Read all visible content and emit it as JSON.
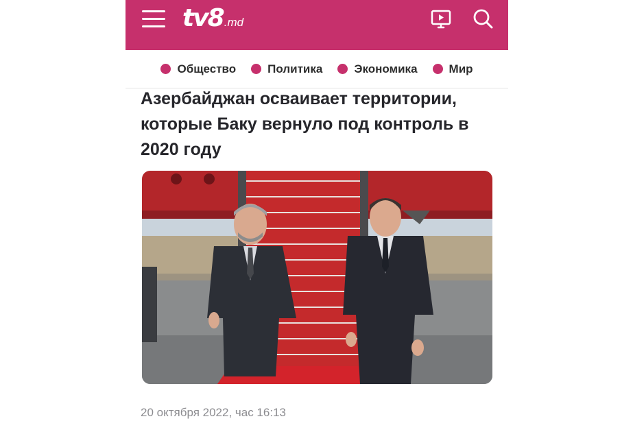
{
  "header": {
    "logo_main": "tv8",
    "logo_sub": ".md",
    "brand_color": "#c6306c",
    "icons": [
      "menu-icon",
      "tv-play-icon",
      "search-icon"
    ]
  },
  "categories": [
    {
      "label": "Общество"
    },
    {
      "label": "Политика"
    },
    {
      "label": "Экономика"
    },
    {
      "label": "Мир"
    }
  ],
  "article": {
    "title": "Азербайджан осваивает территории, которые Баку вернуло под контроль в 2020 году",
    "date": "20 октября 2022, час 16:13"
  }
}
